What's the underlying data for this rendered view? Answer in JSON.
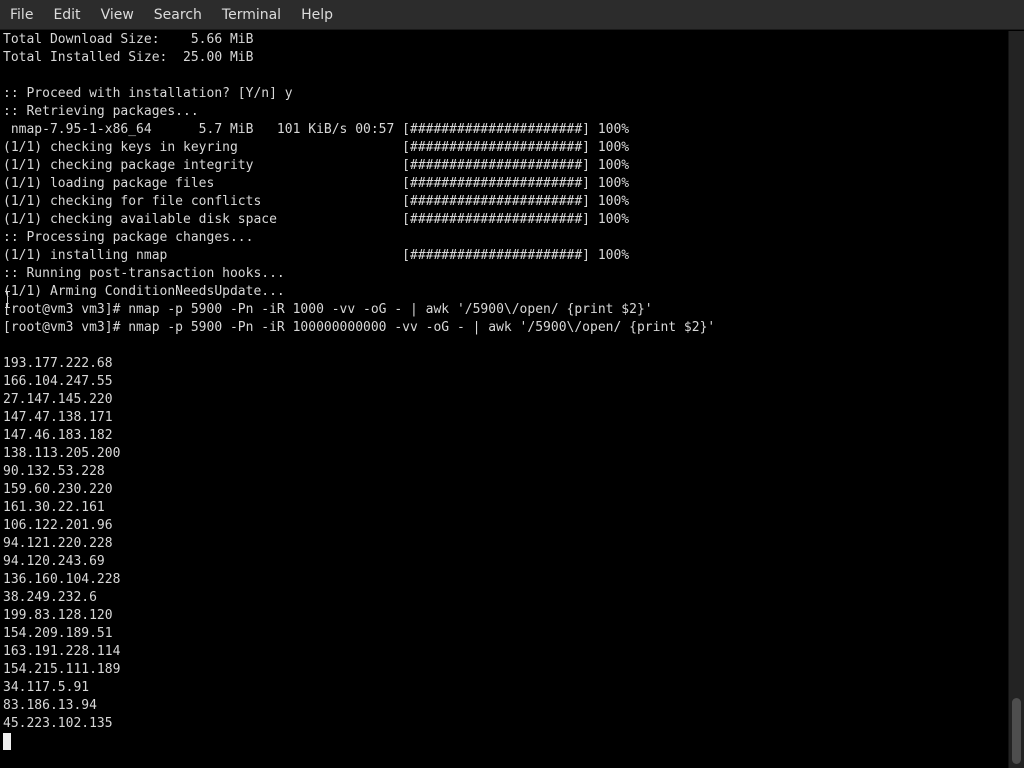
{
  "menubar": {
    "items": [
      "File",
      "Edit",
      "View",
      "Search",
      "Terminal",
      "Help"
    ]
  },
  "terminal": {
    "lines": [
      "Total Download Size:    5.66 MiB",
      "Total Installed Size:  25.00 MiB",
      "",
      ":: Proceed with installation? [Y/n] y",
      ":: Retrieving packages...",
      " nmap-7.95-1-x86_64      5.7 MiB   101 KiB/s 00:57 [######################] 100%",
      "(1/1) checking keys in keyring                     [######################] 100%",
      "(1/1) checking package integrity                   [######################] 100%",
      "(1/1) loading package files                        [######################] 100%",
      "(1/1) checking for file conflicts                  [######################] 100%",
      "(1/1) checking available disk space                [######################] 100%",
      ":: Processing package changes...",
      "(1/1) installing nmap                              [######################] 100%",
      ":: Running post-transaction hooks...",
      "(1/1) Arming ConditionNeedsUpdate...",
      "[root@vm3 vm3]# nmap -p 5900 -Pn -iR 1000 -vv -oG - | awk '/5900\\/open/ {print $2}'",
      "[root@vm3 vm3]# nmap -p 5900 -Pn -iR 100000000000 -vv -oG - | awk '/5900\\/open/ {print $2}'",
      "",
      "193.177.222.68",
      "166.104.247.55",
      "27.147.145.220",
      "147.47.138.171",
      "147.46.183.182",
      "138.113.205.200",
      "90.132.53.228",
      "159.60.230.220",
      "161.30.22.161",
      "106.122.201.96",
      "94.121.220.228",
      "94.120.243.69",
      "136.160.104.228",
      "38.249.232.6",
      "199.83.128.120",
      "154.209.189.51",
      "163.191.228.114",
      "154.215.111.189",
      "34.117.5.91",
      "83.186.13.94",
      "45.223.102.135"
    ]
  },
  "colors": {
    "background": "#000000",
    "text": "#d8d8d8",
    "menubar": "#2c2c2c"
  }
}
